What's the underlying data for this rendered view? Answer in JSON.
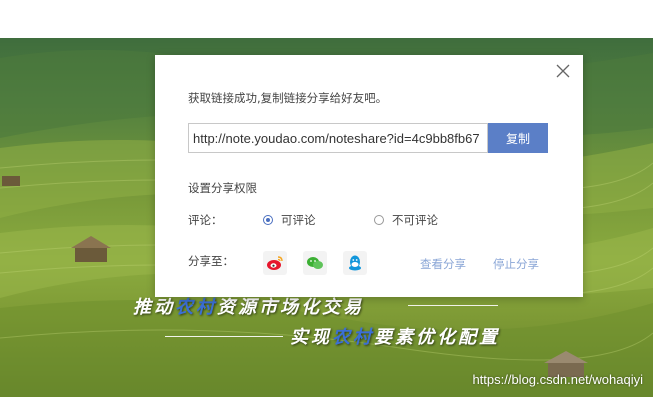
{
  "dialog": {
    "message": "获取链接成功,复制链接分享给好友吧。",
    "link_value": "http://note.youdao.com/noteshare?id=4c9bb8fb67",
    "copy_label": "复制",
    "permission_title": "设置分享权限",
    "comment_label": "评论：",
    "options": [
      {
        "label": "可评论",
        "checked": true
      },
      {
        "label": "不可评论",
        "checked": false
      }
    ],
    "share_label": "分享至：",
    "share_icons": [
      "weibo-icon",
      "wechat-icon",
      "qq-icon"
    ],
    "view_share_label": "查看分享",
    "stop_share_label": "停止分享"
  },
  "background": {
    "slogan_1_pre": "推动",
    "slogan_1_hl": "农村",
    "slogan_1_post": "资源市场化交易",
    "slogan_2_pre": "实现",
    "slogan_2_hl": "农村",
    "slogan_2_post": "要素优化配置",
    "watermark": "https://blog.csdn.net/wohaqiyi"
  },
  "colors": {
    "accent": "#5b7fc7",
    "link": "#8aa6d6",
    "highlight": "#3b6fd6"
  }
}
